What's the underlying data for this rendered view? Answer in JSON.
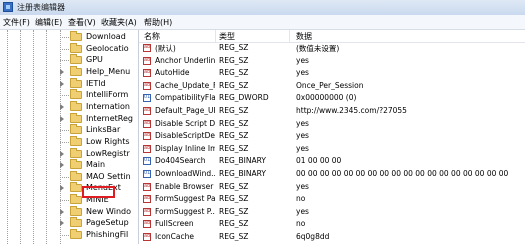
{
  "window": {
    "title": "注册表编辑器"
  },
  "menu": [
    "文件(F)",
    "编辑(E)",
    "查看(V)",
    "收藏夹(A)",
    "帮助(H)"
  ],
  "tree": {
    "selected": "Main",
    "nodes": [
      "Download",
      "Geolocatio",
      "GPU",
      "Help_Menu",
      "IETld",
      "IntelliForm",
      "Internation",
      "InternetReg",
      "LinksBar",
      "Low Rights",
      "LowRegistr",
      "Main",
      "MAO Settin",
      "MenuExt",
      "MINIE",
      "New Windo",
      "PageSetup",
      "PhishingFil"
    ]
  },
  "list": {
    "columns": [
      "名称",
      "类型",
      "数据"
    ],
    "rows": [
      {
        "name": "(默认)",
        "type": "REG_SZ",
        "data": "(数值未设置)",
        "icon": "string"
      },
      {
        "name": "Anchor Underline",
        "type": "REG_SZ",
        "data": "yes",
        "icon": "string"
      },
      {
        "name": "AutoHide",
        "type": "REG_SZ",
        "data": "yes",
        "icon": "string"
      },
      {
        "name": "Cache_Update_F...",
        "type": "REG_SZ",
        "data": "Once_Per_Session",
        "icon": "string"
      },
      {
        "name": "CompatibilityFla...",
        "type": "REG_DWORD",
        "data": "0x00000000 (0)",
        "icon": "binary"
      },
      {
        "name": "Default_Page_URL",
        "type": "REG_SZ",
        "data": "http://www.2345.com/?27055",
        "icon": "string"
      },
      {
        "name": "Disable Script D...",
        "type": "REG_SZ",
        "data": "yes",
        "icon": "string"
      },
      {
        "name": "DisableScriptDe...",
        "type": "REG_SZ",
        "data": "yes",
        "icon": "string"
      },
      {
        "name": "Display Inline Im...",
        "type": "REG_SZ",
        "data": "yes",
        "icon": "string"
      },
      {
        "name": "Do404Search",
        "type": "REG_BINARY",
        "data": "01 00 00 00",
        "icon": "binary"
      },
      {
        "name": "DownloadWind...",
        "type": "REG_BINARY",
        "data": "00 00 00 00 00 00 00 00 00 00 00 00 00 00 00 00 00 00",
        "icon": "binary"
      },
      {
        "name": "Enable Browser ...",
        "type": "REG_SZ",
        "data": "yes",
        "icon": "string"
      },
      {
        "name": "FormSuggest Pa...",
        "type": "REG_SZ",
        "data": "no",
        "icon": "string"
      },
      {
        "name": "FormSuggest P...",
        "type": "REG_SZ",
        "data": "yes",
        "icon": "string"
      },
      {
        "name": "FullScreen",
        "type": "REG_SZ",
        "data": "no",
        "icon": "string"
      },
      {
        "name": "IconCache",
        "type": "REG_SZ",
        "data": "6q0g8dd",
        "icon": "string"
      }
    ]
  }
}
